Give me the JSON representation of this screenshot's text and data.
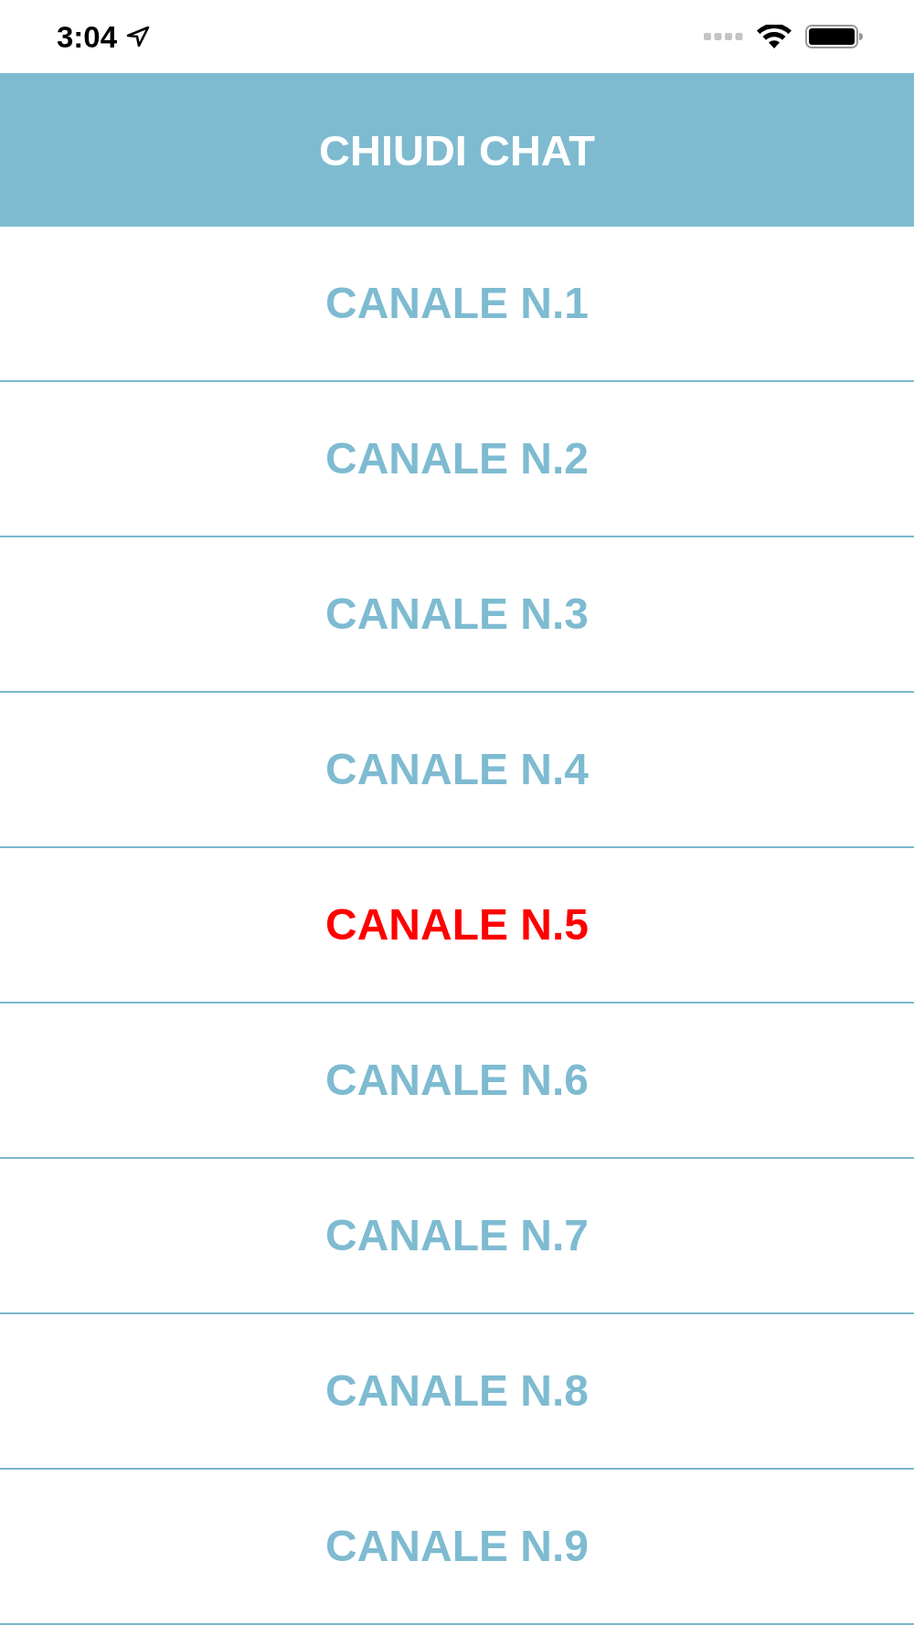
{
  "status_bar": {
    "time": "3:04"
  },
  "header": {
    "title": "CHIUDI CHAT"
  },
  "channels": [
    {
      "label": "CANALE N.1",
      "selected": false
    },
    {
      "label": "CANALE N.2",
      "selected": false
    },
    {
      "label": "CANALE N.3",
      "selected": false
    },
    {
      "label": "CANALE N.4",
      "selected": false
    },
    {
      "label": "CANALE N.5",
      "selected": true
    },
    {
      "label": "CANALE N.6",
      "selected": false
    },
    {
      "label": "CANALE N.7",
      "selected": false
    },
    {
      "label": "CANALE N.8",
      "selected": false
    },
    {
      "label": "CANALE N.9",
      "selected": false
    }
  ]
}
